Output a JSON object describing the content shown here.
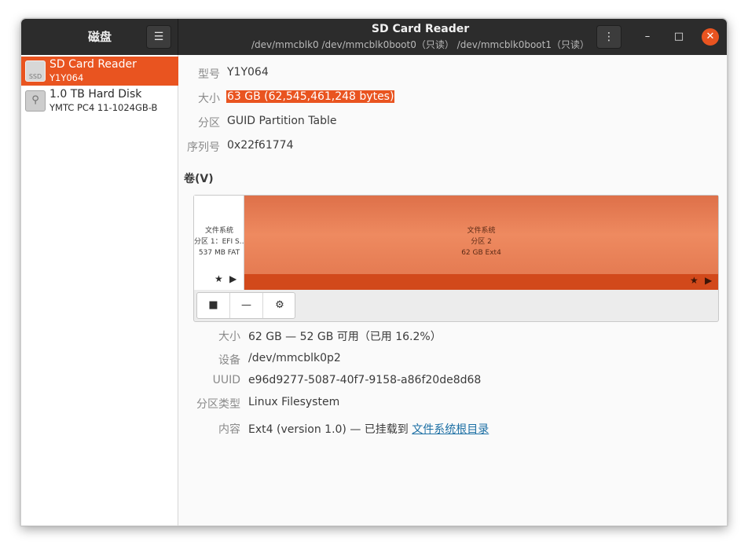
{
  "app": {
    "title": "磁盘",
    "window_title": "SD Card Reader",
    "window_subtitle": "/dev/mmcblk0 /dev/mmcblk0boot0（只读） /dev/mmcblk0boot1（只读）"
  },
  "header": {
    "sidebar_menu_glyph": "☰",
    "drive_menu_glyph": "⋮",
    "minimize_glyph": "–",
    "maximize_glyph": "□",
    "close_glyph": "✕"
  },
  "sidebar": {
    "drives": [
      {
        "name": "SD Card Reader",
        "subtitle": "Y1Y064",
        "icon": "ssd-icon",
        "icon_label": "SSD",
        "selected": true
      },
      {
        "name": "1.0 TB Hard Disk",
        "subtitle": "YMTC PC4 11-1024GB-B",
        "icon": "usb-drive-icon",
        "icon_glyph": "⚲",
        "selected": false
      }
    ]
  },
  "drive_info": {
    "model_label": "型号",
    "model_value": "Y1Y064",
    "size_label": "大小",
    "size_value": "63 GB (62,545,461,248 bytes)",
    "partitioning_label": "分区",
    "partitioning_value": "GUID Partition Table",
    "serial_label": "序列号",
    "serial_value": "0x22f61774"
  },
  "volumes": {
    "section_title": "卷(V)",
    "partitions": [
      {
        "line1": "文件系统",
        "line2": "分区 1：EFI S…",
        "line3": "537 MB FAT",
        "share_fraction": 0.009
      },
      {
        "line1": "文件系统",
        "line2": "分区 2",
        "line3": "62 GB Ext4",
        "share_fraction": 0.991
      }
    ],
    "star_glyph": "★",
    "play_glyph": "▶",
    "toolbar": {
      "stop_glyph": "■",
      "remove_glyph": "—",
      "settings_glyph": "⚙"
    }
  },
  "volume_info": {
    "size_label": "大小",
    "size_value": "62 GB — 52 GB 可用（已用 16.2%）",
    "device_label": "设备",
    "device_value": "/dev/mmcblk0p2",
    "uuid_label": "UUID",
    "uuid_value": "e96d9277-5087-40f7-9158-a86f20de8d68",
    "partition_type_label": "分区类型",
    "partition_type_value": "Linux Filesystem",
    "contents_label": "内容",
    "contents_prefix": "Ext4 (version 1.0) — 已挂载到 ",
    "contents_link": "文件系统根目录"
  },
  "colors": {
    "accent": "#e95420",
    "headerbar": "#2c2c2c",
    "link": "#1c6fa4"
  }
}
